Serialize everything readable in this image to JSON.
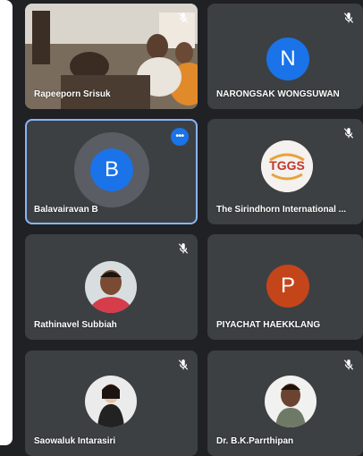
{
  "meeting": {
    "participants": [
      {
        "name": "Rapeeporn Srisuk",
        "type": "video",
        "muted": true
      },
      {
        "name": "NARONGSAK WONGSUWAN",
        "type": "letter",
        "letter": "N",
        "color": "#1a73e8",
        "muted": true
      },
      {
        "name": "Balavairavan B",
        "type": "letter",
        "letter": "B",
        "color": "#1a73e8",
        "muted": false,
        "active": true,
        "more_label": "•••"
      },
      {
        "name": "The Sirindhorn International ...",
        "type": "logo",
        "logo_text": "TGGS",
        "muted": true
      },
      {
        "name": "Rathinavel Subbiah",
        "type": "photo",
        "muted": true
      },
      {
        "name": "PIYACHAT HAEKKLANG",
        "type": "letter",
        "letter": "P",
        "color": "#c5451a",
        "muted": false
      },
      {
        "name": "Saowaluk Intarasiri",
        "type": "photo",
        "muted": true
      },
      {
        "name": "Dr. B.K.Parrthipan",
        "type": "photo",
        "muted": true
      }
    ]
  },
  "colors": {
    "background": "#202124",
    "tile": "#3c4043",
    "active_border": "#8ab4f8"
  },
  "icons": {
    "mic_off": "mic-off-icon",
    "more": "more-options-icon"
  }
}
